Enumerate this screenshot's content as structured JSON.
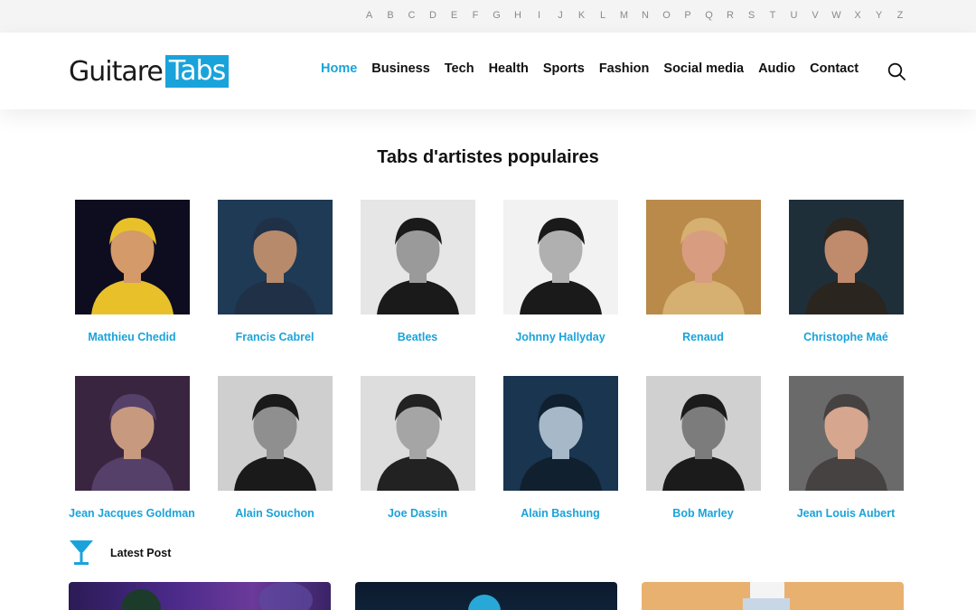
{
  "alphabet": [
    "A",
    "B",
    "C",
    "D",
    "E",
    "F",
    "G",
    "H",
    "I",
    "J",
    "K",
    "L",
    "M",
    "N",
    "O",
    "P",
    "Q",
    "R",
    "S",
    "T",
    "U",
    "V",
    "W",
    "X",
    "Y",
    "Z"
  ],
  "logo": {
    "part1": "Guitare",
    "part2": "Tabs"
  },
  "nav": {
    "items": [
      {
        "label": "Home",
        "active": true
      },
      {
        "label": "Business",
        "active": false
      },
      {
        "label": "Tech",
        "active": false
      },
      {
        "label": "Health",
        "active": false
      },
      {
        "label": "Sports",
        "active": false
      },
      {
        "label": "Fashion",
        "active": false
      },
      {
        "label": "Social media",
        "active": false
      },
      {
        "label": "Audio",
        "active": false
      },
      {
        "label": "Contact",
        "active": false
      }
    ]
  },
  "section_title": "Tabs d'artistes populaires",
  "artists": [
    {
      "name": "Matthieu Chedid"
    },
    {
      "name": "Francis Cabrel"
    },
    {
      "name": "Beatles"
    },
    {
      "name": "Johnny Hallyday"
    },
    {
      "name": "Renaud"
    },
    {
      "name": "Christophe Maé"
    },
    {
      "name": "Jean Jacques Goldman"
    },
    {
      "name": "Alain Souchon"
    },
    {
      "name": "Joe Dassin"
    },
    {
      "name": "Alain Bashung"
    },
    {
      "name": "Bob Marley"
    },
    {
      "name": "Jean Louis Aubert"
    }
  ],
  "latest": {
    "label": "Latest Post",
    "icon": "cocktail-glass-icon"
  },
  "colors": {
    "accent": "#1aa3db",
    "alpha_bar_bg": "#f4f4f4",
    "text": "#111111"
  }
}
